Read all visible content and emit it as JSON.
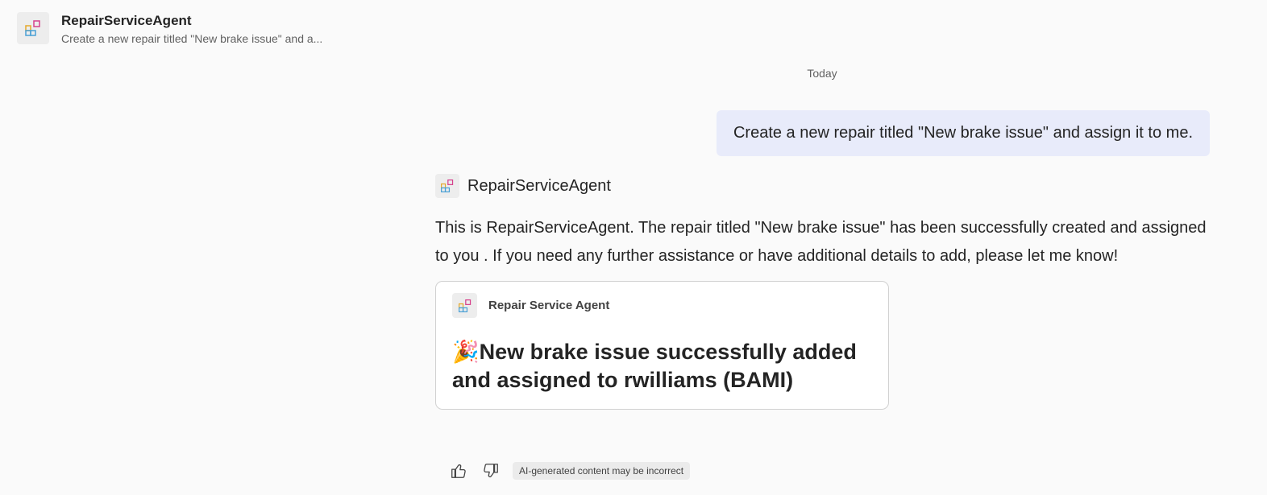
{
  "header": {
    "title": "RepairServiceAgent",
    "subtitle": "Create a new repair titled \"New brake issue\" and a..."
  },
  "conversation": {
    "date_label": "Today",
    "user_message": "Create a new repair titled \"New brake issue\" and assign it to me.",
    "bot_name": "RepairServiceAgent",
    "bot_message": "This is RepairServiceAgent. The repair titled \"New brake issue\" has been successfully created and assigned to you . If you need any further assistance or have additional details to add, please let me know!",
    "card": {
      "source": "Repair Service Agent",
      "emoji": "🎉",
      "title": "New brake issue successfully added and assigned to rwilliams (BAMI)"
    }
  },
  "feedback": {
    "like_icon": "thumbs-up-icon",
    "dislike_icon": "thumbs-down-icon",
    "disclaimer": "AI-generated content may be incorrect"
  },
  "colors": {
    "background": "#fafafa",
    "user_bubble": "#e8ebfa",
    "card_border": "#d1d1d1"
  }
}
